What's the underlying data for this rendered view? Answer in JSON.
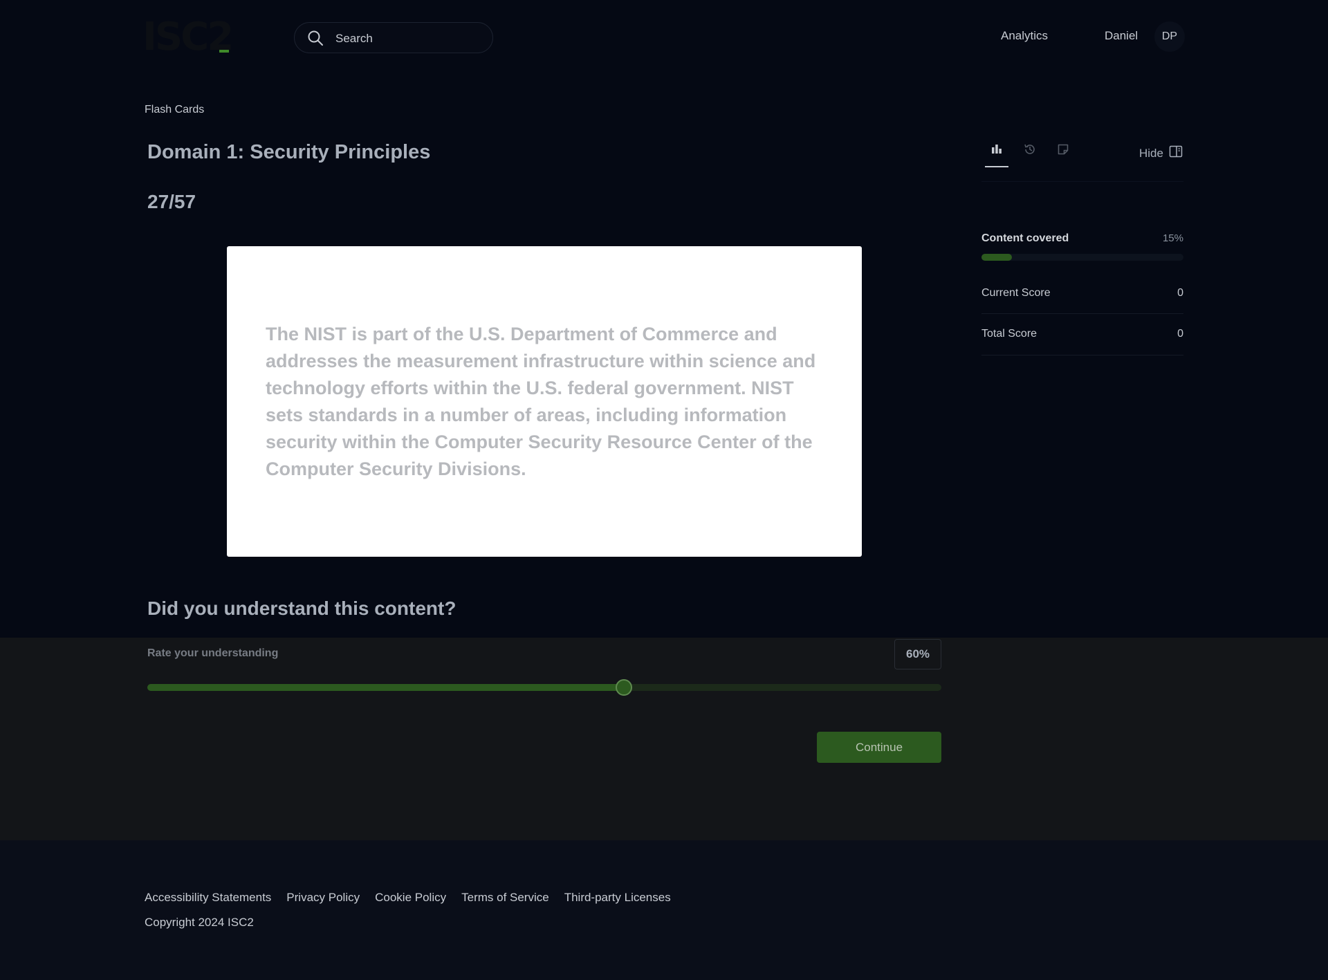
{
  "header": {
    "logo_text": "ISC2",
    "search_placeholder": "Search",
    "nav_analytics": "Analytics",
    "user_name": "Daniel",
    "user_initials": "DP"
  },
  "main": {
    "breadcrumb": "Flash Cards",
    "title": "Domain 1: Security Principles",
    "counter": "27/57",
    "card_text": "The NIST is part of the U.S. Department of Commerce and addresses the measurement infrastructure within science and technology efforts within the U.S. federal government. NIST sets standards in a number of areas, including information security within the Computer Security Resource Center of the Computer Security Divisions."
  },
  "panel": {
    "hide_label": "Hide",
    "content_covered_label": "Content covered",
    "content_covered_value": "15%",
    "content_covered_fraction": 0.15,
    "current_score_label": "Current Score",
    "current_score_value": "0",
    "total_score_label": "Total Score",
    "total_score_value": "0"
  },
  "rating": {
    "question": "Did you understand this content?",
    "label": "Rate your understanding",
    "value_text": "60%",
    "fraction": 0.6,
    "continue_label": "Continue"
  },
  "footer": {
    "links": [
      "Accessibility Statements",
      "Privacy Policy",
      "Cookie Policy",
      "Terms of Service",
      "Third-party Licenses"
    ],
    "copyright": "Copyright 2024 ISC2"
  },
  "colors": {
    "accent_green": "#2c5a1f",
    "background": "#050914"
  }
}
